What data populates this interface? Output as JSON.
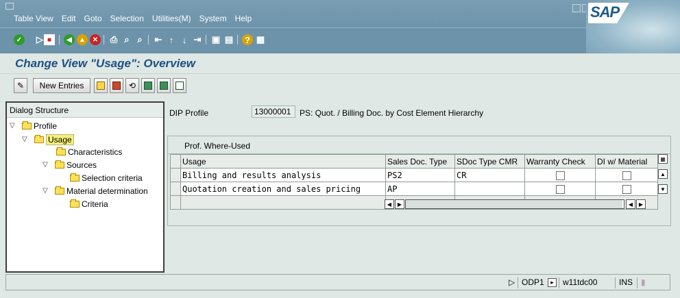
{
  "menubar": {
    "items": [
      "Table View",
      "Edit",
      "Goto",
      "Selection",
      "Utilities(M)",
      "System",
      "Help"
    ]
  },
  "branding": {
    "logo_text": "SAP"
  },
  "page": {
    "title": "Change View \"Usage\": Overview"
  },
  "app_toolbar": {
    "new_entries_label": "New Entries"
  },
  "dialog_structure": {
    "heading": "Dialog Structure",
    "nodes": [
      {
        "label": "Profile",
        "expanded": true
      },
      {
        "label": "Usage",
        "expanded": true,
        "selected": true
      },
      {
        "label": "Characteristics"
      },
      {
        "label": "Sources",
        "expanded": true
      },
      {
        "label": "Selection criteria"
      },
      {
        "label": "Material determination",
        "expanded": true
      },
      {
        "label": "Criteria"
      }
    ]
  },
  "profile": {
    "label": "DIP Profile",
    "value": "13000001",
    "description": "PS: Quot. / Billing Doc. by Cost Element Hierarchy"
  },
  "table": {
    "title": "Prof. Where-Used",
    "columns": [
      "Usage",
      "Sales Doc. Type",
      "SDoc Type CMR",
      "Warranty Check",
      "DI w/ Material"
    ],
    "rows": [
      {
        "usage": "Billing and results analysis",
        "sales_doc_type": "PS2",
        "sdoc_type_cmr": "CR",
        "warranty_check": false,
        "di_material": false
      },
      {
        "usage": "Quotation creation and sales pricing",
        "sales_doc_type": "AP",
        "sdoc_type_cmr": "",
        "warranty_check": false,
        "di_material": false
      },
      {
        "usage": "",
        "sales_doc_type": "",
        "sdoc_type_cmr": "",
        "warranty_check": null,
        "di_material": null
      }
    ]
  },
  "statusbar": {
    "system": "ODP1",
    "server": "w11tdc00",
    "mode": "INS"
  }
}
